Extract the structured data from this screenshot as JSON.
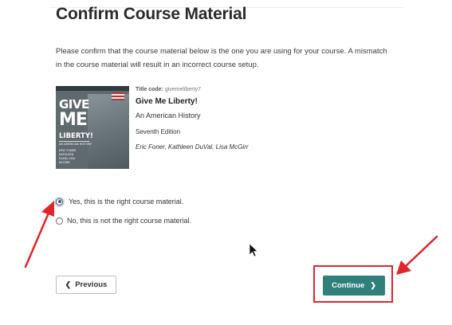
{
  "page": {
    "title": "Confirm Course Material",
    "intro": "Please confirm that the course material below is the one you are using for your course. A mismatch in the course material will result in an incorrect course setup."
  },
  "book": {
    "title_code_label": "Title code:",
    "title_code_value": "givemeliberty7",
    "title": "Give Me Liberty!",
    "subtitle": "An American History",
    "edition": "Seventh Edition",
    "authors": "Eric Foner, Kathleen DuVal, Lisa McGirr",
    "cover": {
      "line1": "GIVE",
      "line2": "ME",
      "line3": "LIBERTY!",
      "line4": "AN AMERICAN HISTORY",
      "line5": "ERIC FONER KATHLEEN DuVAL LISA McGIRR"
    }
  },
  "options": [
    {
      "label": "Yes, this is the right course material.",
      "checked": true
    },
    {
      "label": "No, this is not the right course material.",
      "checked": false
    }
  ],
  "buttons": {
    "previous": "Previous",
    "continue": "Continue"
  },
  "icons": {
    "previous": "chevron-left-icon",
    "continue": "chevron-right-icon",
    "annotation": "red-arrow"
  },
  "colors": {
    "continue_bg": "#2f7f7a",
    "highlight": "#e0252b",
    "arrow": "#e0252b"
  }
}
